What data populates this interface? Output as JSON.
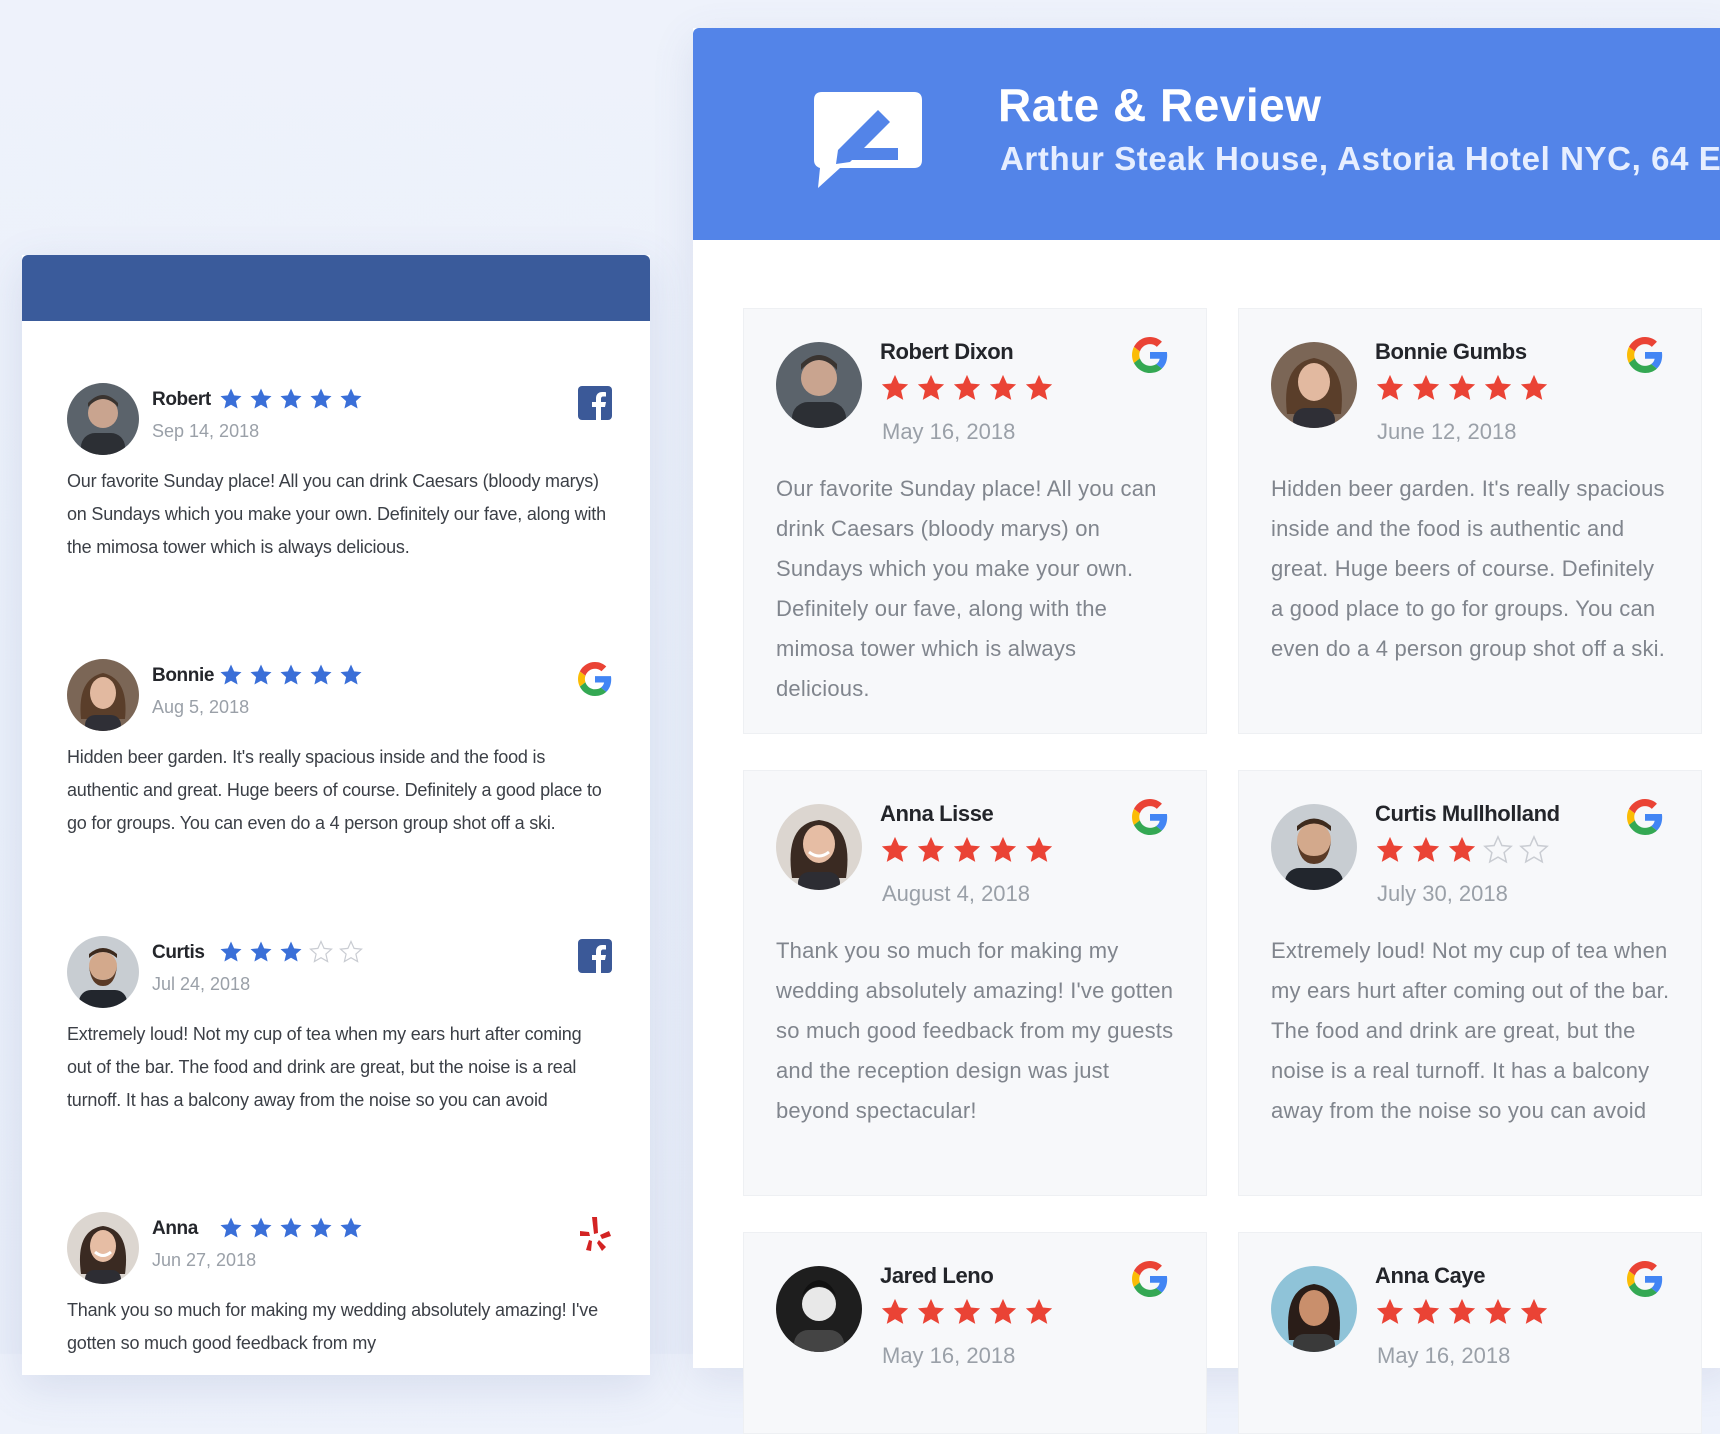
{
  "app": {
    "title": "Rate & Review",
    "subtitle": "Arthur Steak House, Astoria Hotel NYC, 64 E",
    "colors": {
      "header_blue": "#5384e8",
      "left_header": "#3a5b9b",
      "red_star": "#ea4335",
      "blue_star": "#3a6fd8"
    }
  },
  "left_reviews": [
    {
      "name": "Robert",
      "date": "Sep 14, 2018",
      "rating": 5,
      "source": "facebook-icon",
      "text": "Our favorite Sunday place! All you can drink Caesars (bloody marys) on Sundays which you make your own. Definitely our fave, along with the mimosa tower which is always delicious."
    },
    {
      "name": "Bonnie",
      "date": "Aug 5, 2018",
      "rating": 5,
      "source": "google-icon",
      "text": "Hidden beer garden. It's really spacious inside and the food is authentic and great. Huge beers of course. Definitely a good place to go for groups. You can even do a 4 person group shot off a ski."
    },
    {
      "name": "Curtis",
      "date": "Jul 24, 2018",
      "rating": 3,
      "source": "facebook-icon",
      "text": "Extremely loud! Not my cup of tea when my ears hurt after coming out of the bar. The food and drink are great, but the noise is a real turnoff. It has a balcony away from the noise so you can avoid"
    },
    {
      "name": "Anna",
      "date": "Jun 27, 2018",
      "rating": 5,
      "source": "yelp-icon",
      "text": "Thank you so much for making my wedding absolutely amazing! I've gotten so much good feedback from my"
    }
  ],
  "cards": [
    {
      "name": "Robert Dixon",
      "date": "May 16, 2018",
      "rating": 5,
      "text": "Our favorite Sunday place! All you can drink Caesars (bloody marys) on Sundays which you make your own. Definitely our fave, along with the mimosa tower which is always delicious."
    },
    {
      "name": "Bonnie Gumbs",
      "date": "June 12, 2018",
      "rating": 5,
      "text": "Hidden beer garden. It's really spacious inside and the food is authentic and great. Huge beers of course. Definitely a good place to go for groups. You can even do a 4 person group shot off a ski."
    },
    {
      "name": "Anna Lisse",
      "date": "August 4, 2018",
      "rating": 5,
      "text": "Thank you so much for making my wedding absolutely amazing! I've gotten so much good feedback from my guests and the reception design was just beyond spectacular!"
    },
    {
      "name": "Curtis Mullholland",
      "date": "July 30, 2018",
      "rating": 3,
      "text": "Extremely loud! Not my cup of tea when my ears hurt after coming out of the bar. The food and drink are great, but the noise is a real turnoff. It has a balcony away from the noise so you can avoid"
    },
    {
      "name": "Jared Leno",
      "date": "May 16, 2018",
      "rating": 5,
      "text": ""
    },
    {
      "name": "Anna Caye",
      "date": "May 16, 2018",
      "rating": 5,
      "text": ""
    }
  ]
}
